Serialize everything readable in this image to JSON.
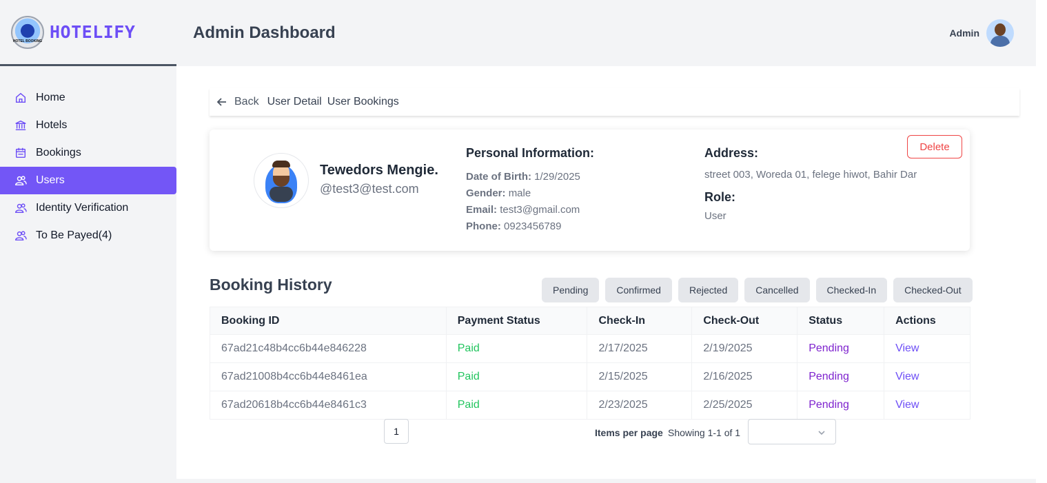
{
  "brand": {
    "name": "HOTELIFY",
    "logo_text": "HOTEL BOOKING"
  },
  "sidebar": {
    "items": [
      {
        "label": "Home",
        "icon": "home-icon"
      },
      {
        "label": "Hotels",
        "icon": "bank-icon"
      },
      {
        "label": "Bookings",
        "icon": "calendar-icon"
      },
      {
        "label": "Users",
        "icon": "users-icon",
        "active": true
      },
      {
        "label": "Identity Verification",
        "icon": "users-icon"
      },
      {
        "label": "To Be Payed(4)",
        "icon": "users-icon"
      }
    ]
  },
  "header": {
    "title": "Admin Dashboard",
    "user_label": "Admin"
  },
  "breadcrumb": {
    "back": "Back",
    "user_detail": "User Detail",
    "user_bookings": "User Bookings"
  },
  "profile": {
    "name": "Tewedors Mengie.",
    "handle": "@test3@test.com",
    "personal_title": "Personal Information:",
    "dob_label": "Date of Birth:",
    "dob": "1/29/2025",
    "gender_label": "Gender:",
    "gender": "male",
    "email_label": "Email:",
    "email": "test3@gmail.com",
    "phone_label": "Phone:",
    "phone": "0923456789",
    "address_title": "Address:",
    "address": "street 003, Woreda 01, felege hiwot, Bahir Dar",
    "role_title": "Role:",
    "role": "User",
    "delete_label": "Delete"
  },
  "booking_history": {
    "title": "Booking History",
    "filters": [
      "Pending",
      "Confirmed",
      "Rejected",
      "Cancelled",
      "Checked-In",
      "Checked-Out"
    ],
    "columns": [
      "Booking ID",
      "Payment Status",
      "Check-In",
      "Check-Out",
      "Status",
      "Actions"
    ],
    "rows": [
      {
        "id": "67ad21c48b4cc6b44e846228",
        "payment": "Paid",
        "check_in": "2/17/2025",
        "check_out": "2/19/2025",
        "status": "Pending",
        "action": "View"
      },
      {
        "id": "67ad21008b4cc6b44e8461ea",
        "payment": "Paid",
        "check_in": "2/15/2025",
        "check_out": "2/16/2025",
        "status": "Pending",
        "action": "View"
      },
      {
        "id": "67ad20618b4cc6b44e8461c3",
        "payment": "Paid",
        "check_in": "2/23/2025",
        "check_out": "2/25/2025",
        "status": "Pending",
        "action": "View"
      }
    ]
  },
  "pagination": {
    "page": "1",
    "items_per_page_label": "Items per page",
    "showing": "Showing 1-1 of 1",
    "select_value": ""
  },
  "colors": {
    "accent": "#6d4ef6",
    "active_nav": "#7356f6",
    "paid": "#22c55e",
    "pending": "#7e22ce",
    "delete": "#ef4444"
  }
}
